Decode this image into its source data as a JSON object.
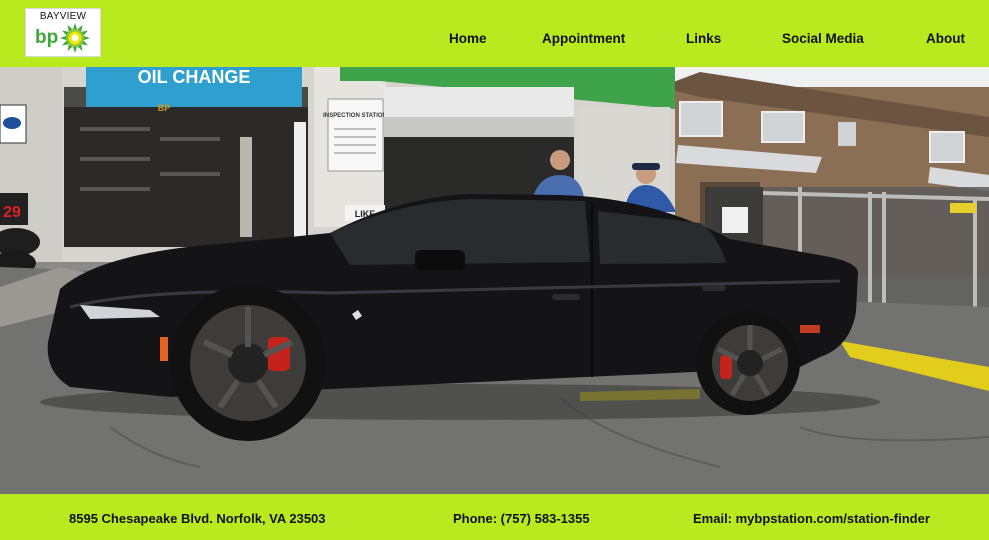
{
  "header": {
    "logo": {
      "top_text": "BAYVIEW",
      "brand": "bp"
    },
    "nav": [
      {
        "label": "Home"
      },
      {
        "label": "Appointment"
      },
      {
        "label": "Links"
      },
      {
        "label": "Social Media"
      },
      {
        "label": "About"
      }
    ]
  },
  "hero": {
    "signs": {
      "oil_change": "OIL CHANGE",
      "inspection": "INSPECTION STATION",
      "like": "LIKE",
      "bp_small": "BP",
      "digital": "29"
    }
  },
  "footer": {
    "address": "8595 Chesapeake Blvd. Norfolk, VA 23503",
    "phone": "Phone: (757) 583-1355",
    "email": "Email: mybpstation.com/station-finder"
  },
  "colors": {
    "brand_green": "#b9ea1f",
    "bp_green": "#3aaa35",
    "bp_yellow": "#f2e600"
  }
}
